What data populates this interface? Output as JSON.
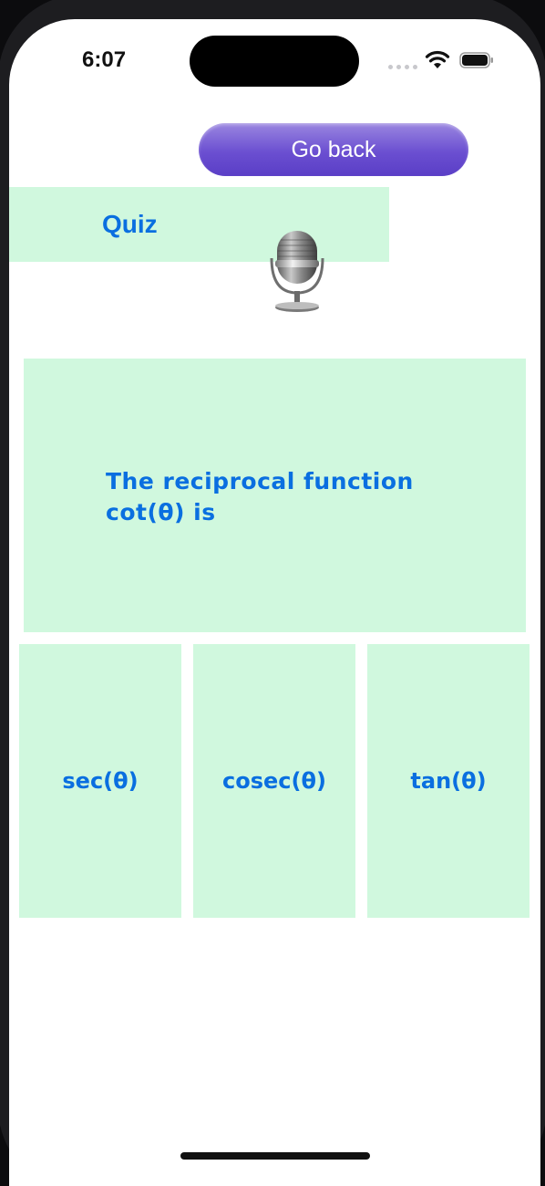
{
  "status_bar": {
    "time": "6:07",
    "icons": [
      "signal-dots-icon",
      "wifi-icon",
      "battery-icon"
    ]
  },
  "header": {
    "go_back_label": "Go back",
    "title": "Quiz",
    "mic_icon": "microphone-icon"
  },
  "question": {
    "text": "The reciprocal function cot(θ) is"
  },
  "answers": [
    {
      "label": "sec(θ)"
    },
    {
      "label": "cosec(θ)"
    },
    {
      "label": "tan(θ)"
    }
  ],
  "colors": {
    "card_background": "#d0f8de",
    "text_blue": "#0a6fe0",
    "button_purple": "#6b4fd1"
  }
}
